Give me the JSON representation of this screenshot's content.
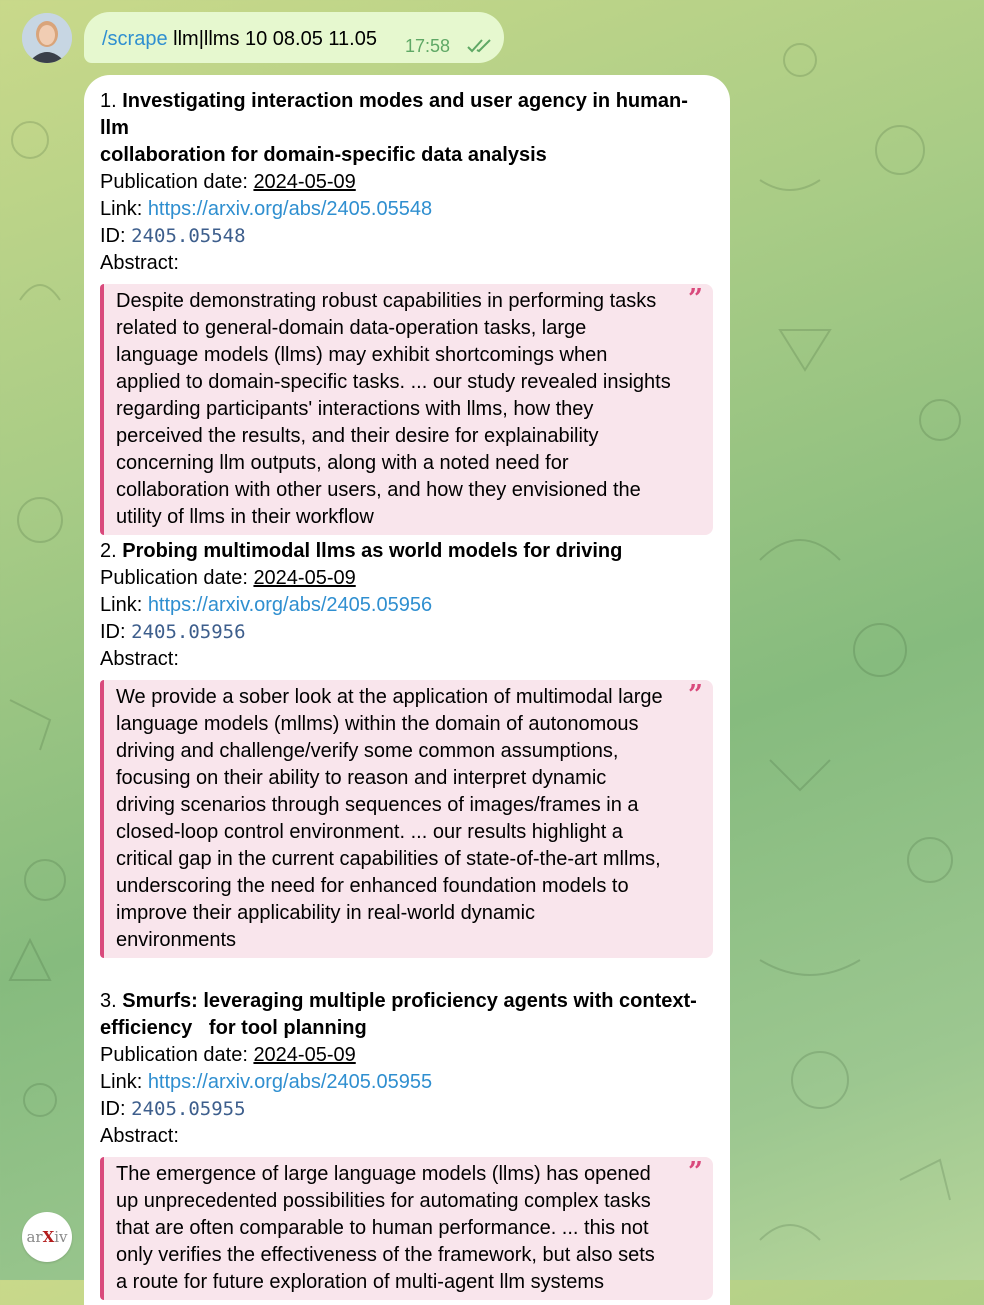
{
  "chat": {
    "outgoing": {
      "command": "/scrape",
      "args": " llm|llms 10 08.05 11.05",
      "time": "17:58"
    },
    "bot_avatar": {
      "text_pre": "ar",
      "text_x": "X",
      "text_post": "iv"
    },
    "labels": {
      "pub_date": "Publication date: ",
      "link": "Link: ",
      "id": "ID: ",
      "abstract": "Abstract:"
    },
    "papers": [
      {
        "num": "1. ",
        "title_1": "Investigating interaction modes and user agency in human-llm",
        "title_2": "collaboration for domain-specific data analysis",
        "date": "2024-05-09",
        "url": "https://arxiv.org/abs/2405.05548",
        "id": "2405.05548",
        "abstract": [
          "Despite demonstrating robust capabilities in performing tasks",
          "related to general-domain data-operation tasks, large",
          "language models (llms) may exhibit shortcomings when",
          "applied to domain-specific tasks. ... our study revealed insights",
          "regarding participants' interactions with llms, how they",
          "perceived the results, and their desire for explainability",
          "concerning llm outputs, along with a noted need for",
          "collaboration with other users, and how they envisioned the",
          "utility of llms in their workflow"
        ]
      },
      {
        "num": "2. ",
        "title_1": "Probing multimodal llms as world models for driving",
        "title_2": "",
        "date": "2024-05-09",
        "url": "https://arxiv.org/abs/2405.05956",
        "id": "2405.05956",
        "abstract": [
          "We provide a sober look at the application of multimodal large",
          "language models (mllms) within the domain of autonomous",
          "driving and challenge/verify some common assumptions,",
          "focusing on their ability to reason and interpret dynamic",
          "driving scenarios through sequences of images/frames in a",
          "closed-loop control environment. ... our results highlight a",
          "critical gap in the current capabilities of state-of-the-art mllms,",
          "underscoring the need for enhanced foundation models to",
          "improve their applicability in real-world dynamic",
          "environments"
        ]
      },
      {
        "num": "3. ",
        "title_1": "Smurfs: leveraging multiple proficiency agents with context-",
        "title_2": "efficiency   for tool planning",
        "date": "2024-05-09",
        "url": "https://arxiv.org/abs/2405.05955",
        "id": "2405.05955",
        "abstract": [
          "The emergence of large language models (llms) has opened",
          "up unprecedented possibilities for automating complex tasks",
          "that are often comparable to human performance. ... this not",
          "only verifies the effectiveness of the framework, but also sets",
          "a route for future exploration of multi-agent llm systems"
        ]
      }
    ]
  }
}
